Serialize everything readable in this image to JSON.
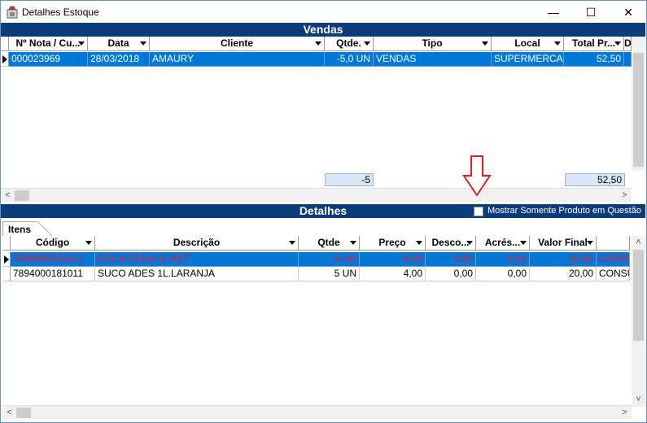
{
  "window": {
    "title": "Detalhes Estoque",
    "minimize": "—",
    "maximize": "☐",
    "close": "✕"
  },
  "vendas": {
    "header": "Vendas",
    "columns": [
      "Nº Nota / Cu...",
      "Data",
      "Cliente",
      "Qtde.",
      "Tipo",
      "Local",
      "Total Pr...",
      "D"
    ],
    "rows": [
      {
        "nota": "000023969",
        "data": "28/03/2018",
        "cliente": "AMAURY",
        "qtde": "-5,0 UN",
        "tipo": "VENDAS",
        "local": "SUPERMERCADO",
        "total": "52,50",
        "d": ""
      }
    ],
    "totals": {
      "qtde": "-5",
      "total": "52,50"
    }
  },
  "detalhes": {
    "header": "Detalhes",
    "show_only_label": "Mostrar  Somente Produto em Questão",
    "show_only_checked": false,
    "tab": "Itens",
    "columns": [
      "Código",
      "Descrição",
      "Qtde",
      "Preço",
      "Desco...",
      "Acrés...",
      "Valor Final",
      ""
    ],
    "rows": [
      {
        "codigo": "7894900011517",
        "descricao": "COCA COLA 2L PET",
        "qtde": "5 UN",
        "preco": "6,50",
        "desconto": "0,00",
        "acrescimo": "0,00",
        "valor": "32,50",
        "extra": "CONSU"
      },
      {
        "codigo": "7894000181011",
        "descricao": "SUCO ADES 1L.LARANJA",
        "qtde": "5 UN",
        "preco": "4,00",
        "desconto": "0,00",
        "acrescimo": "0,00",
        "valor": "20,00",
        "extra": "CONSU"
      }
    ]
  },
  "colors": {
    "header_bg": "#0c3c7c",
    "selection": "#0078d7",
    "red_text": "#e8203a",
    "annotation_arrow": "#e02020"
  },
  "icons": [
    "app-icon",
    "minimize-icon",
    "maximize-icon",
    "close-icon",
    "row-indicator-icon",
    "sort-arrow-icon",
    "scroll-arrow-icon",
    "down-arrow-annotation-icon"
  ]
}
